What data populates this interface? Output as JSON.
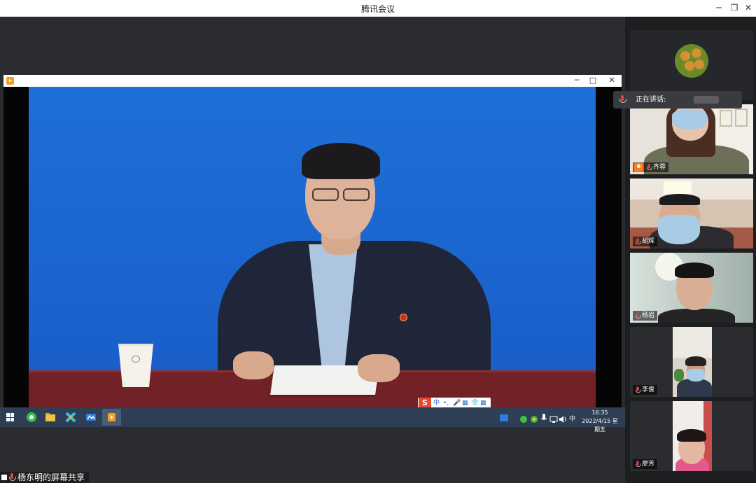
{
  "window": {
    "title": "腾讯会议",
    "minimize": "─",
    "restore": "❐",
    "close": "✕"
  },
  "player": {
    "minimize": "─",
    "maximize": "□",
    "close": "✕"
  },
  "ime": {
    "logo": "S",
    "lang": "中",
    "items": [
      "•,",
      "🎤",
      "▦",
      "👕",
      "▦"
    ]
  },
  "taskbar": {
    "tray_lang": "中",
    "time": "16:35",
    "date": "2022/4/15 星期五"
  },
  "share_label": "杨东明的屏幕共享",
  "speaking": {
    "label": "正在讲话:"
  },
  "participants": [
    {
      "name": ""
    },
    {
      "name": "齐蓉",
      "host": true
    },
    {
      "name": "胡辉"
    },
    {
      "name": "杨岩"
    },
    {
      "name": "李俊"
    },
    {
      "name": "廖芳"
    }
  ],
  "colors": {
    "video_bg": "#1f6fd6",
    "desk": "#722226",
    "taskbar": "#2e3f55",
    "panel_bg": "#1d1e20",
    "host_badge": "#ff7a1a"
  }
}
